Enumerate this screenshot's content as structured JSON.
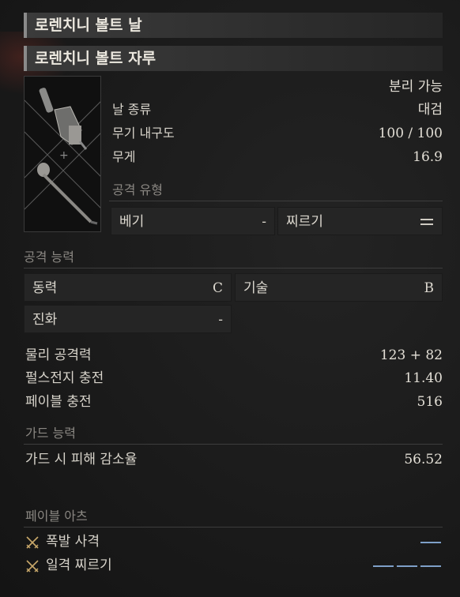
{
  "header": {
    "blade_name": "로렌치니 볼트 날",
    "handle_name": "로렌치니 볼트 자루"
  },
  "specs": {
    "separable": "분리 가능",
    "blade_type_label": "날 종류",
    "blade_type_value": "대검",
    "durability_label": "무기 내구도",
    "durability_value": "100 / 100",
    "weight_label": "무게",
    "weight_value": "16.9"
  },
  "attack_type": {
    "title": "공격 유형",
    "slash_label": "베기",
    "slash_value": "-",
    "pierce_label": "찌르기",
    "pierce_icon": "equals-icon"
  },
  "attack_ability": {
    "title": "공격 능력",
    "motivity_label": "동력",
    "motivity_grade": "C",
    "technique_label": "기술",
    "technique_grade": "B",
    "advance_label": "진화",
    "advance_grade": "-"
  },
  "stats": {
    "physical_label": "물리 공격력",
    "physical_value": "123 + 82",
    "pulse_label": "펄스전지 충전",
    "pulse_value": "11.40",
    "fable_label": "페이블 충전",
    "fable_value": "516"
  },
  "guard": {
    "title": "가드 능력",
    "reduction_label": "가드 시 피해 감소율",
    "reduction_value": "56.52"
  },
  "fable_arts": {
    "title": "페이블 아츠",
    "items": [
      {
        "label": "폭발 사격",
        "cost_slots": 1
      },
      {
        "label": "일격 찌르기",
        "cost_slots": 3
      }
    ]
  },
  "colors": {
    "cost_bar": "#7ea0c8",
    "accent_icon": "#c9a86a"
  }
}
